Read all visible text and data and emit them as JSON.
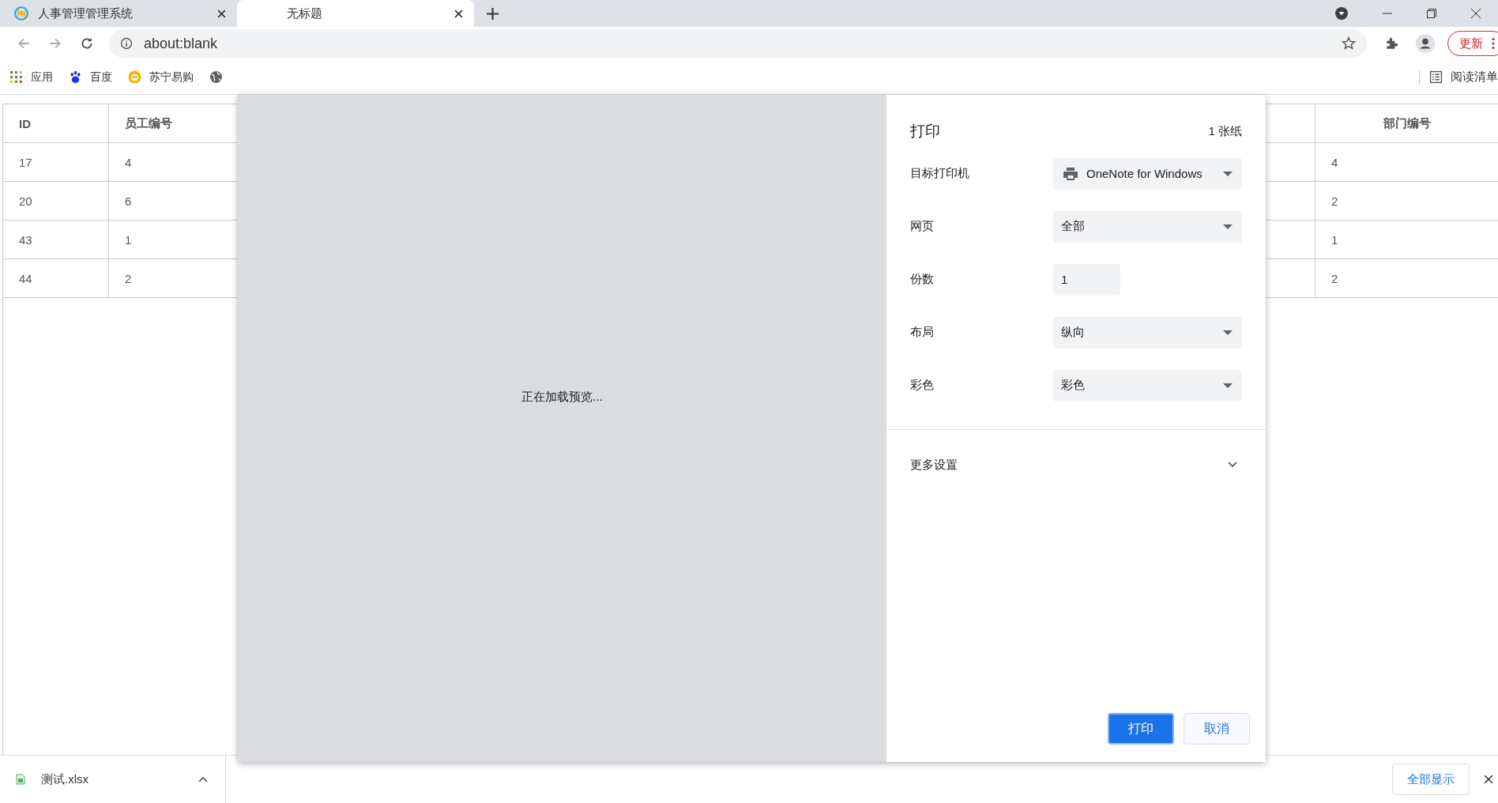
{
  "browser": {
    "tabs": [
      {
        "title": "人事管理管理系统",
        "selected": false
      },
      {
        "title": "无标题",
        "selected": true
      }
    ],
    "address": "about:blank",
    "update_button": "更新",
    "bookmarks": [
      "应用",
      "百度",
      "苏宁易购"
    ],
    "reading_list": "阅读清单"
  },
  "table": {
    "columns": [
      "ID",
      "员工编号",
      "部门编号"
    ],
    "rows": [
      [
        "17",
        "4",
        "4"
      ],
      [
        "20",
        "6",
        "2"
      ],
      [
        "43",
        "1",
        "1"
      ],
      [
        "44",
        "2",
        "2"
      ]
    ]
  },
  "print_dialog": {
    "preview_status": "正在加载预览...",
    "title": "打印",
    "sheet_count": "1 张纸",
    "settings": [
      {
        "label": "目标打印机",
        "kind": "printer",
        "value": "OneNote for Windows"
      },
      {
        "label": "网页",
        "kind": "select",
        "value": "全部"
      },
      {
        "label": "份数",
        "kind": "input",
        "value": "1"
      },
      {
        "label": "布局",
        "kind": "select",
        "value": "纵向"
      },
      {
        "label": "彩色",
        "kind": "select",
        "value": "彩色"
      }
    ],
    "more_settings": {
      "label": "更多设置",
      "expanded": false
    },
    "buttons": [
      {
        "label": "打印",
        "kind": "primary"
      },
      {
        "label": "取消",
        "kind": "secondary"
      }
    ]
  },
  "downloads": {
    "file": "测试.xlsx",
    "show_all": "全部显示"
  }
}
